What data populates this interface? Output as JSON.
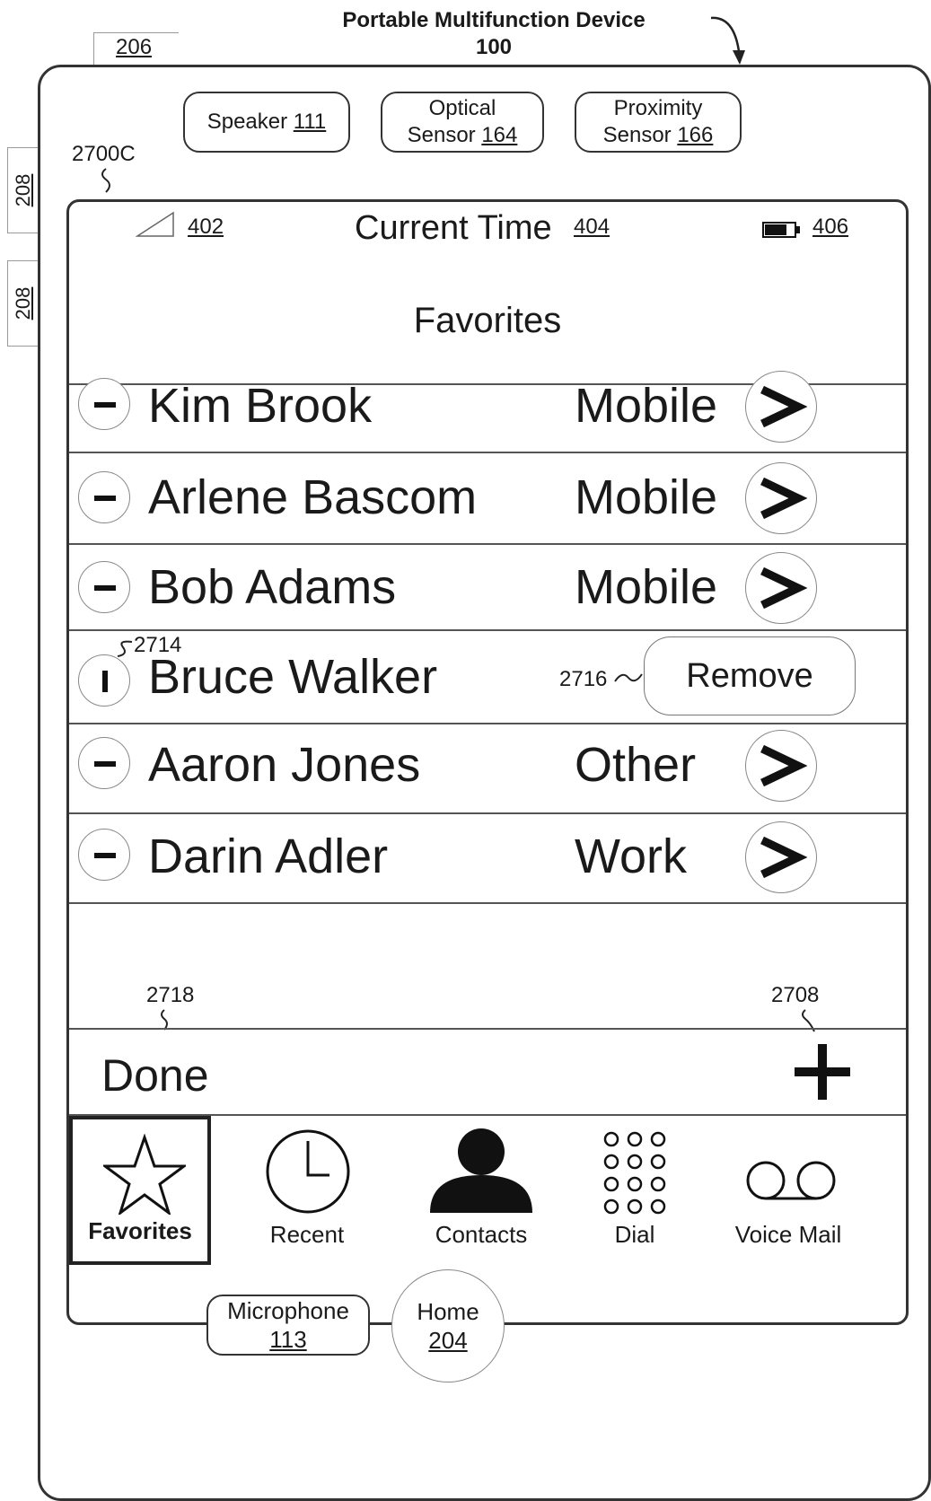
{
  "header": {
    "title_line1": "Portable Multifunction Device",
    "title_line2": "100",
    "ref_206": "206",
    "ref_208a": "208",
    "ref_208b": "208",
    "ref_2700c": "2700C"
  },
  "sensors": {
    "speaker": {
      "name": "Speaker",
      "num": "111"
    },
    "optical": {
      "line1": "Optical",
      "name": "Sensor",
      "num": "164"
    },
    "proximity": {
      "line1": "Proximity",
      "name": "Sensor",
      "num": "166"
    }
  },
  "status_bar": {
    "signal_ref": "402",
    "time_label": "Current Time",
    "time_ref": "404",
    "battery_ref": "406"
  },
  "nav": {
    "title": "Favorites"
  },
  "favorites": [
    {
      "name": "Kim Brook",
      "type": "Mobile"
    },
    {
      "name": "Arlene Bascom",
      "type": "Mobile"
    },
    {
      "name": "Bob Adams",
      "type": "Mobile"
    },
    {
      "name": "Bruce Walker",
      "remove_label": "Remove",
      "ref_2714": "2714",
      "ref_2716": "2716"
    },
    {
      "name": "Aaron Jones",
      "type": "Other"
    },
    {
      "name": "Darin Adler",
      "type": "Work"
    }
  ],
  "actions": {
    "done_label": "Done",
    "done_ref": "2718",
    "add_ref": "2708"
  },
  "tabs": [
    {
      "label": "Favorites",
      "icon": "star-icon",
      "selected": true
    },
    {
      "label": "Recent",
      "icon": "clock-icon"
    },
    {
      "label": "Contacts",
      "icon": "person-icon"
    },
    {
      "label": "Dial",
      "icon": "keypad-icon"
    },
    {
      "label": "Voice Mail",
      "icon": "voicemail-icon"
    }
  ],
  "hardware": {
    "microphone": {
      "name": "Microphone",
      "num": "113"
    },
    "home": {
      "name": "Home",
      "num": "204"
    }
  },
  "colors": {
    "line": "#333333",
    "background": "#ffffff"
  }
}
